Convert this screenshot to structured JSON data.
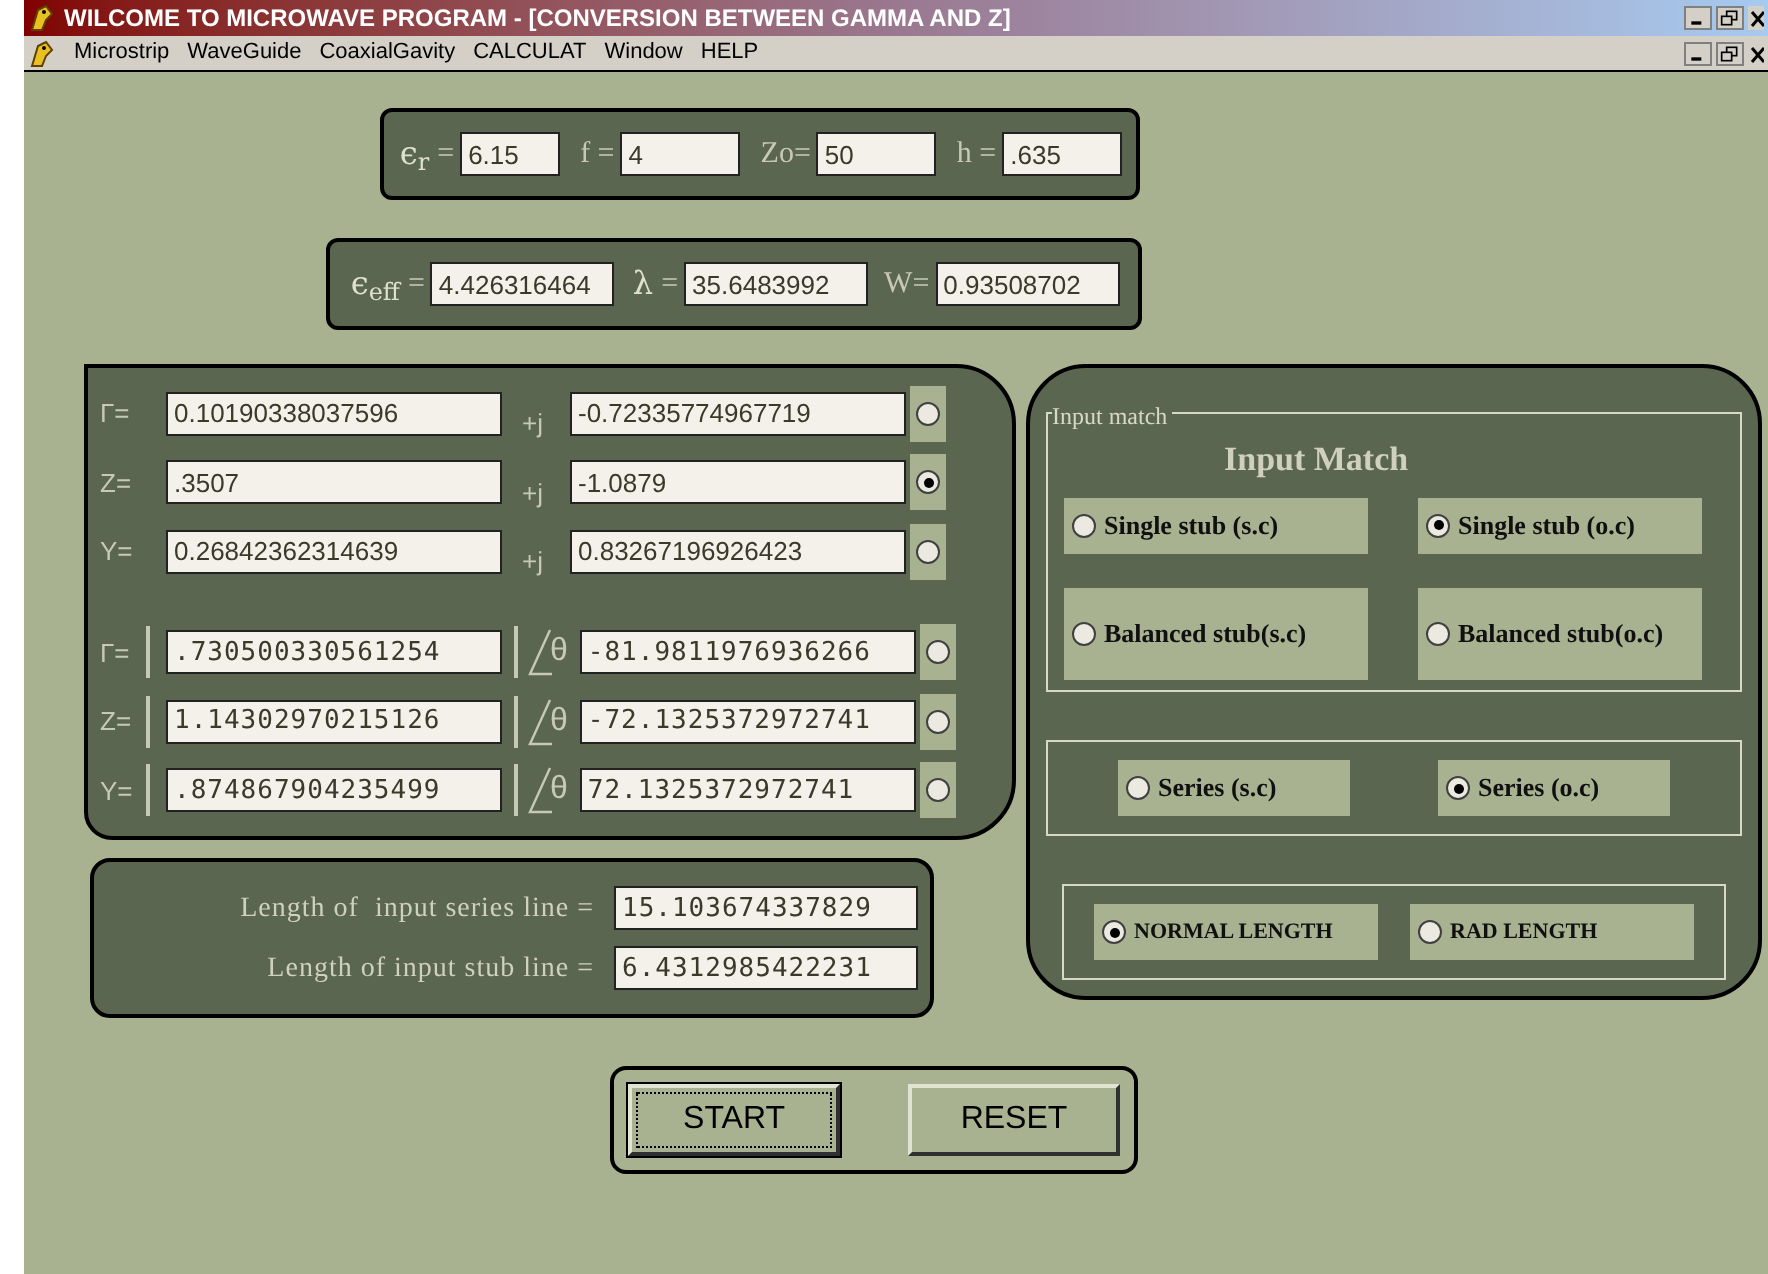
{
  "window": {
    "title": "WILCOME TO MICROWAVE PROGRAM - [CONVERSION BETWEEN GAMMA AND Z]"
  },
  "menu": [
    "Microstrip",
    "WaveGuide",
    "CoaxialGavity",
    "CALCULAT",
    "Window",
    "HELP"
  ],
  "inputs": [
    {
      "symbol": "є",
      "sub": "r",
      "label": "=",
      "value": "6.15"
    },
    {
      "label": "f =",
      "value": "4"
    },
    {
      "label": "Zo=",
      "value": "50"
    },
    {
      "label": "h =",
      "value": ".635"
    }
  ],
  "results": [
    {
      "symbol": "є",
      "sub": "eff",
      "label": "=",
      "value": "4.426316464"
    },
    {
      "symbol": "λ",
      "label": "=",
      "value": "35.6483992"
    },
    {
      "label": "W=",
      "value": "0.93508702"
    }
  ],
  "rows": [
    {
      "kind": "cartesian",
      "label": "Γ=",
      "a": "0.10190338037596",
      "sep": "+j",
      "b": "-0.72335774967719",
      "selected": false
    },
    {
      "kind": "cartesian",
      "label": "Z=",
      "a": ".3507",
      "sep": "+j",
      "b": "-1.0879",
      "selected": true
    },
    {
      "kind": "cartesian",
      "label": "Y=",
      "a": "0.26842362314639",
      "sep": "+j",
      "b": "0.83267196926423",
      "selected": false
    },
    {
      "kind": "polar",
      "label": "Γ=",
      "a": ".730500330561254",
      "sep": "θ",
      "b": "-81.9811976936266",
      "selected": false
    },
    {
      "kind": "polar",
      "label": "Z=",
      "a": "1.14302970215126",
      "sep": "θ",
      "b": "-72.1325372972741",
      "selected": false
    },
    {
      "kind": "polar",
      "label": "Y=",
      "a": ".874867904235499",
      "sep": "θ",
      "b": "72.1325372972741",
      "selected": false
    }
  ],
  "lengths": [
    {
      "label": "Length of  input series line =",
      "value": "15.103674337829"
    },
    {
      "label": "Length of input stub line =",
      "value": "6.4312985422231"
    }
  ],
  "match": {
    "legend": "Input match",
    "heading": "Input Match",
    "options": [
      {
        "label": "Single stub (s.c)",
        "selected": false
      },
      {
        "label": "Single stub (o.c)",
        "selected": true
      },
      {
        "label": "Balanced stub(s.c)",
        "selected": false
      },
      {
        "label": "Balanced stub(o.c)",
        "selected": false
      }
    ],
    "series": [
      {
        "label": "Series (s.c)",
        "selected": false
      },
      {
        "label": "Series (o.c)",
        "selected": true
      }
    ],
    "length_mode": [
      {
        "label": "NORMAL LENGTH",
        "selected": true
      },
      {
        "label": "RAD LENGTH",
        "selected": false
      }
    ]
  },
  "buttons": [
    {
      "label": "START",
      "focused": true
    },
    {
      "label": "RESET",
      "focused": false
    }
  ]
}
